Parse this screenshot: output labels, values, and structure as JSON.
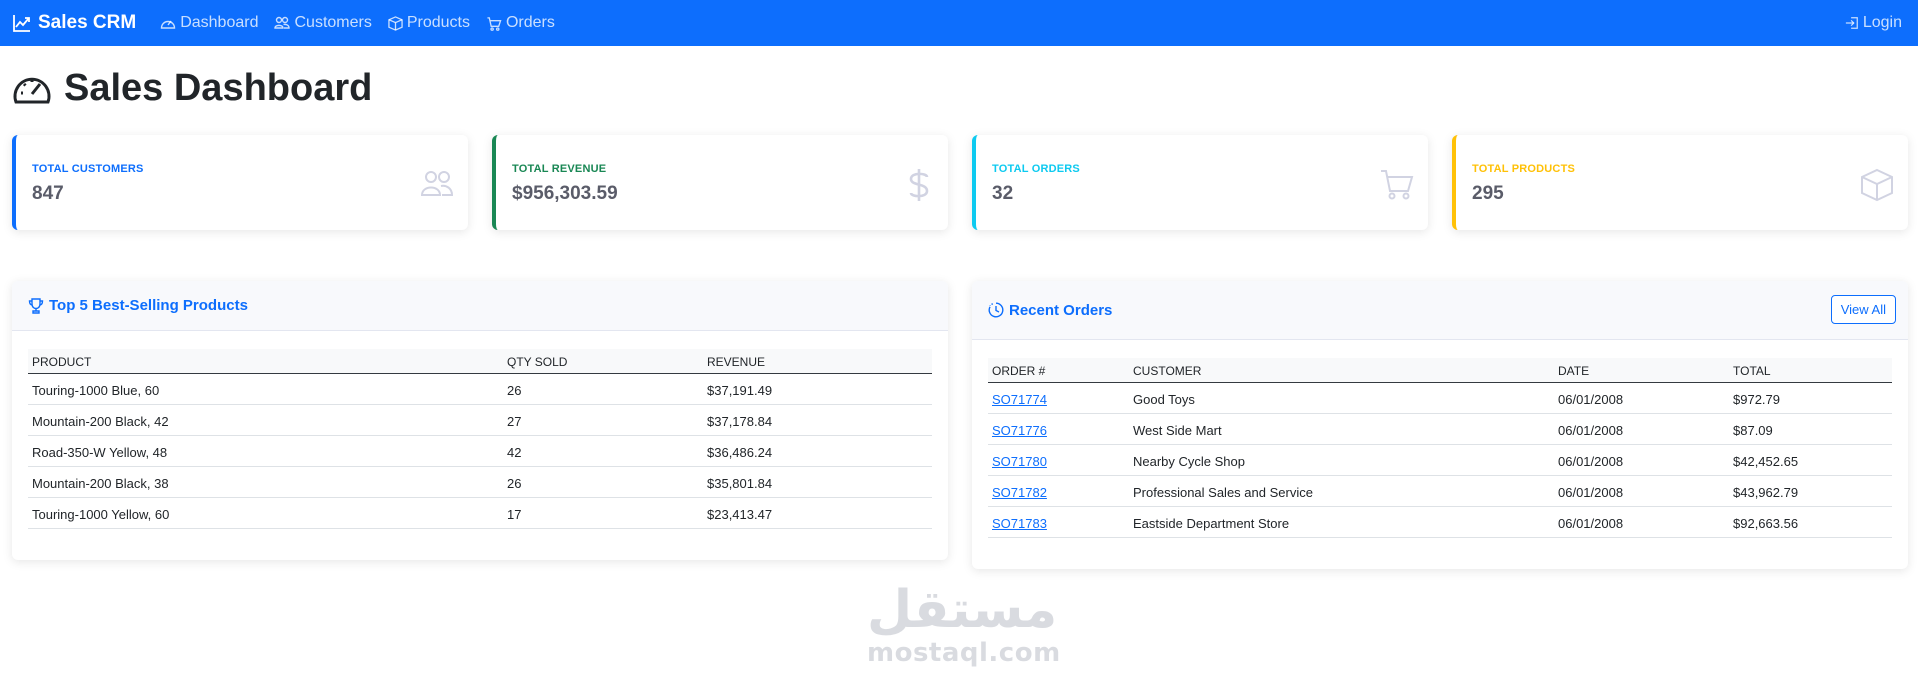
{
  "navbar": {
    "brand": "Sales CRM",
    "links": [
      {
        "label": "Dashboard",
        "icon": "speedometer-icon"
      },
      {
        "label": "Customers",
        "icon": "people-icon"
      },
      {
        "label": "Products",
        "icon": "box-icon"
      },
      {
        "label": "Orders",
        "icon": "cart-icon"
      }
    ],
    "login": "Login",
    "bg_color": "#0d6efd"
  },
  "page_title": "Sales Dashboard",
  "stats": [
    {
      "label": "TOTAL CUSTOMERS",
      "value": "847",
      "color": "#0d6efd",
      "icon": "people-icon"
    },
    {
      "label": "TOTAL REVENUE",
      "value": "$956,303.59",
      "color": "#198754",
      "icon": "dollar-icon"
    },
    {
      "label": "TOTAL ORDERS",
      "value": "32",
      "color": "#0dcaf0",
      "icon": "cart-icon"
    },
    {
      "label": "TOTAL PRODUCTS",
      "value": "295",
      "color": "#ffc107",
      "icon": "box-icon"
    }
  ],
  "top_products": {
    "title": "Top 5 Best-Selling Products",
    "columns": [
      "PRODUCT",
      "QTY SOLD",
      "REVENUE"
    ],
    "rows": [
      [
        "Touring-1000 Blue, 60",
        "26",
        "$37,191.49"
      ],
      [
        "Mountain-200 Black, 42",
        "27",
        "$37,178.84"
      ],
      [
        "Road-350-W Yellow, 48",
        "42",
        "$36,486.24"
      ],
      [
        "Mountain-200 Black, 38",
        "26",
        "$35,801.84"
      ],
      [
        "Touring-1000 Yellow, 60",
        "17",
        "$23,413.47"
      ]
    ]
  },
  "recent_orders": {
    "title": "Recent Orders",
    "view_all": "View All",
    "columns": [
      "ORDER #",
      "CUSTOMER",
      "DATE",
      "TOTAL"
    ],
    "rows": [
      [
        "SO71774",
        "Good Toys",
        "06/01/2008",
        "$972.79"
      ],
      [
        "SO71776",
        "West Side Mart",
        "06/01/2008",
        "$87.09"
      ],
      [
        "SO71780",
        "Nearby Cycle Shop",
        "06/01/2008",
        "$42,452.65"
      ],
      [
        "SO71782",
        "Professional Sales and Service",
        "06/01/2008",
        "$43,962.79"
      ],
      [
        "SO71783",
        "Eastside Department Store",
        "06/01/2008",
        "$92,663.56"
      ]
    ]
  },
  "watermark": {
    "arabic": "مستقل",
    "latin": "mostaql.com"
  }
}
